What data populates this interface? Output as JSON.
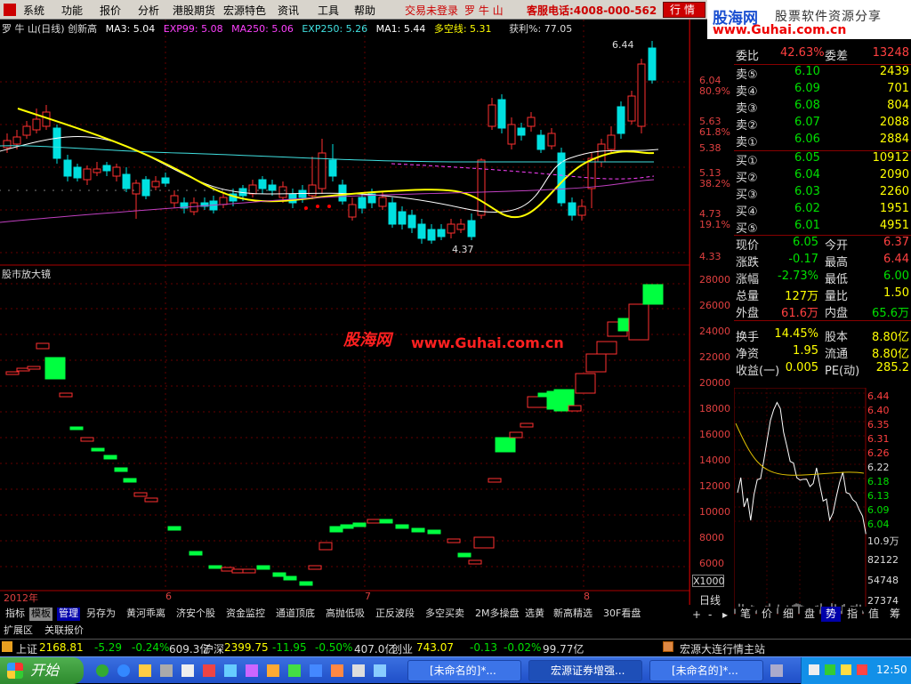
{
  "menubar": {
    "items": [
      "系统",
      "功能",
      "报价",
      "分析",
      "港股期货",
      "宏源特色",
      "资讯",
      "工具",
      "帮助"
    ],
    "login": "交易未登录",
    "stock": "罗 牛 山",
    "service": "客服电话:4008-000-562",
    "quotes_btn": "行情",
    "win_controls": [
      "_",
      "▫",
      "×"
    ]
  },
  "brand": {
    "logo": "股海网",
    "slogan": "股票软件资源分享",
    "url": "www.Guhai.com.cn"
  },
  "kline": {
    "title": "罗 牛 山(日线) 创新高",
    "ma3": "MA3: 5.04",
    "exp99": "EXP99: 5.08",
    "ma250": "MA250: 5.06",
    "exp250": "EXP250: 5.26",
    "ma1": "MA1: 5.44",
    "duokong": "多空线: 5.31",
    "profit": "获利%: 77.05",
    "high_mark": "6.44",
    "low_mark": "4.37",
    "axis": [
      "6.04",
      "80.9%",
      "5.63",
      "61.8%",
      "5.38",
      "5.13",
      "38.2%",
      "4.73",
      "19.1%",
      "4.33"
    ]
  },
  "sub": {
    "title": "股市放大镜",
    "watermark_cn": "股海网",
    "watermark_url": "www.Guhai.com.cn",
    "axis": [
      "28000",
      "26000",
      "24000",
      "22000",
      "20000",
      "18000",
      "16000",
      "14000",
      "12000",
      "10000",
      "8000",
      "6000"
    ],
    "unit": "X1000"
  },
  "xaxis": {
    "year": "2012年",
    "m6": "6",
    "m7": "7",
    "m8": "8"
  },
  "period": "日线",
  "tabs": [
    "指标",
    "模板",
    "管理",
    "另存为",
    "黄河乖离",
    "济安个股",
    "资金监控",
    "通道顶底",
    "高抛低吸",
    "正反波段",
    "多空买卖",
    "2M多操盘",
    "选黄",
    "新高精选",
    "30F看盘"
  ],
  "tabs2": [
    "扩展区",
    "关联报价"
  ],
  "chart_data": {
    "type": "candlestick",
    "title": "罗 牛 山(日线) 创新高",
    "xlabel": "",
    "ylabel": "",
    "ylim": [
      4.33,
      6.44
    ],
    "x": [
      "2012-05",
      "2012-06",
      "2012-07",
      "2012-08"
    ],
    "series": [
      {
        "name": "MA3",
        "values": [
          5.04
        ]
      },
      {
        "name": "EXP99",
        "values": [
          5.08
        ]
      },
      {
        "name": "MA250",
        "values": [
          5.06
        ]
      },
      {
        "name": "EXP250",
        "values": [
          5.26
        ]
      },
      {
        "name": "MA1",
        "values": [
          5.44
        ]
      },
      {
        "name": "多空线",
        "values": [
          5.31
        ]
      },
      {
        "name": "获利%",
        "values": [
          77.05
        ]
      }
    ],
    "annotations": [
      {
        "label": "6.44",
        "kind": "high"
      },
      {
        "label": "4.37",
        "kind": "low"
      }
    ]
  },
  "quote": {
    "weibi_label": "委比",
    "weibi": "42.63%",
    "weicha_label": "委差",
    "weicha": "13248",
    "sells": [
      {
        "l": "卖⑤",
        "p": "6.10",
        "v": "2439"
      },
      {
        "l": "卖④",
        "p": "6.09",
        "v": "701"
      },
      {
        "l": "卖③",
        "p": "6.08",
        "v": "804"
      },
      {
        "l": "卖②",
        "p": "6.07",
        "v": "2088"
      },
      {
        "l": "卖①",
        "p": "6.06",
        "v": "2884"
      }
    ],
    "buys": [
      {
        "l": "买①",
        "p": "6.05",
        "v": "10912"
      },
      {
        "l": "买②",
        "p": "6.04",
        "v": "2090"
      },
      {
        "l": "买③",
        "p": "6.03",
        "v": "2260"
      },
      {
        "l": "买④",
        "p": "6.02",
        "v": "1951"
      },
      {
        "l": "买⑤",
        "p": "6.01",
        "v": "4951"
      }
    ],
    "stats": [
      {
        "a": "现价",
        "av": "6.05",
        "b": "今开",
        "bv": "6.37"
      },
      {
        "a": "涨跌",
        "av": "-0.17",
        "b": "最高",
        "bv": "6.44"
      },
      {
        "a": "涨幅",
        "av": "-2.73%",
        "b": "最低",
        "bv": "6.00"
      },
      {
        "a": "总量",
        "av": "127万",
        "b": "量比",
        "bv": "1.50"
      },
      {
        "a": "外盘",
        "av": "61.6万",
        "b": "内盘",
        "bv": "65.6万"
      },
      {
        "a": "换手",
        "av": "14.45%",
        "b": "股本",
        "bv": "8.80亿"
      },
      {
        "a": "净资",
        "av": "1.95",
        "b": "流通",
        "bv": "8.80亿"
      },
      {
        "a": "收益(一)",
        "av": "0.005",
        "b": "PE(动)",
        "bv": "285.2"
      }
    ],
    "mini_axis": [
      "6.44",
      "6.40",
      "6.35",
      "6.31",
      "6.26",
      "6.22",
      "6.18",
      "6.13",
      "6.09",
      "6.04"
    ],
    "vol_axis": [
      "10.9万",
      "82122",
      "54748",
      "27374"
    ],
    "bottom_tabs": [
      "笔",
      "价",
      "细",
      "盘",
      "势",
      "指",
      "值",
      "筹"
    ]
  },
  "indexbar": {
    "sh_label": "上证",
    "sh": "2168.81",
    "sh_chg": "-5.29",
    "sh_pct": "-0.24%",
    "sh_amt": "609.3亿",
    "hs_label": "沪深",
    "hs": "2399.75",
    "hs_chg": "-11.95",
    "hs_pct": "-0.50%",
    "hs_amt": "407.0亿",
    "cy_label": "创业",
    "cy": "743.07",
    "cy_chg": "-0.13",
    "cy_pct": "-0.02%",
    "cy_amt": "99.77亿",
    "station": "宏源大连行情主站"
  },
  "taskbar": {
    "start": "开始",
    "items": [
      "[未命名的]*...",
      "宏源证券增强...",
      "[未命名的]*..."
    ],
    "time": "12:50"
  }
}
